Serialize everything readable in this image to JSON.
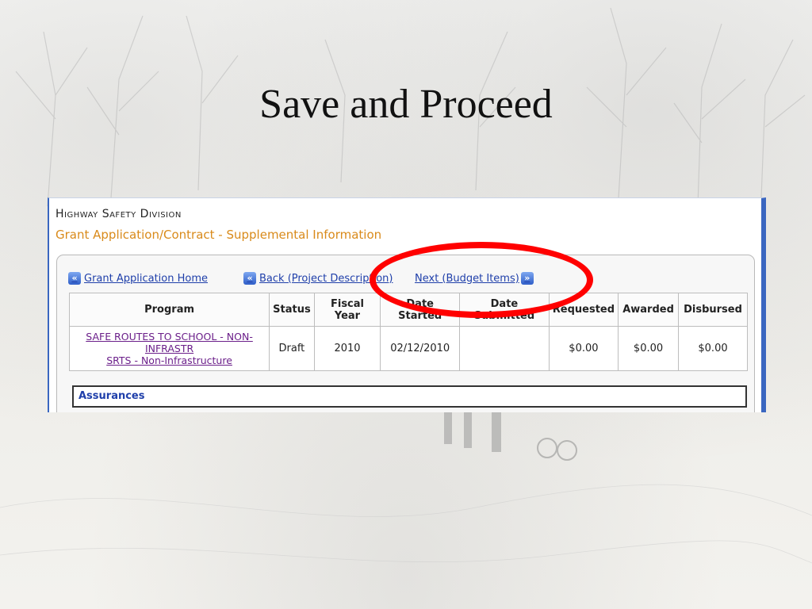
{
  "slide": {
    "title": "Save and Proceed"
  },
  "app": {
    "division": "Highway Safety Division",
    "subtitle": "Grant Application/Contract - Supplemental Information"
  },
  "nav": {
    "home_label": "Grant Application Home",
    "back_label": "Back (Project Description)",
    "next_label": "Next (Budget Items)"
  },
  "table": {
    "headers": {
      "program": "Program",
      "status": "Status",
      "fiscal_year_line1": "Fiscal",
      "fiscal_year_line2": "Year",
      "date_started_line1": "Date",
      "date_started_line2": "Started",
      "date_submitted_line1": "Date",
      "date_submitted_line2": "Submitted",
      "requested": "Requested",
      "awarded": "Awarded",
      "disbursed": "Disbursed"
    },
    "rows": [
      {
        "program_line1": "SAFE ROUTES TO SCHOOL - NON-",
        "program_line2": "INFRASTR",
        "program_line3": "SRTS - Non-Infrastructure",
        "status": "Draft",
        "fiscal_year": "2010",
        "date_started": "02/12/2010",
        "date_submitted": "",
        "requested": "$0.00",
        "awarded": "$0.00",
        "disbursed": "$0.00"
      }
    ]
  },
  "sections": {
    "assurances": "Assurances"
  },
  "colors": {
    "accent_orange": "#d98a1a",
    "link_blue": "#1f3faa",
    "annotation_red": "#ff0000",
    "frame_blue": "#3a66c0"
  },
  "icons": {
    "home": "double-left-arrow-icon",
    "back": "double-left-arrow-icon",
    "next": "double-right-arrow-icon"
  }
}
